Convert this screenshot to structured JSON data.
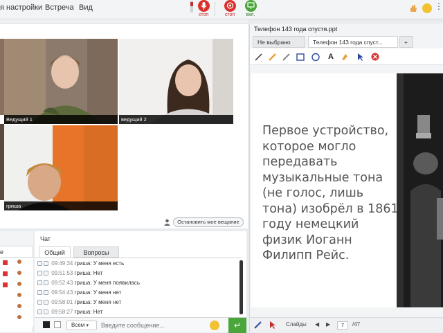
{
  "menu": {
    "items": [
      "я настройки",
      "Встреча",
      "Вид"
    ]
  },
  "controls": {
    "mic_label": "стоп",
    "cam_label": "стоп",
    "share_label": "вкл."
  },
  "videos": {
    "host1_name": "Ведущий 1",
    "host2_name": "ведущий 2",
    "participant_name": "гриша",
    "stop_broadcast_label": "Остановить мое вещание"
  },
  "chat": {
    "title": "Чат",
    "tabs": [
      "Общий",
      "Вопросы"
    ],
    "messages": [
      {
        "time": "09:49:34",
        "text": "гриша: У меня есть"
      },
      {
        "time": "09:51:53",
        "text": "гриша: Нет"
      },
      {
        "time": "09:52:43",
        "text": "гриша: У меня появилась"
      },
      {
        "time": "09:54:43",
        "text": "гриша: У меня нет"
      },
      {
        "time": "09:58:01",
        "text": "гриша: У меня нет"
      },
      {
        "time": "09:58:27",
        "text": "гриша: Нет"
      }
    ],
    "recipient": "Всем",
    "input_placeholder": "Введите сообщение..."
  },
  "presentation": {
    "title": "Телефон 143 года спустя.ppt",
    "tabs": [
      "Не выбрано",
      "Телефон 143 года спуст..."
    ],
    "slide_text": "Первое устройство, которое могло передавать музыкальные тона (не голос, лишь тона) изобрёл в 1861 году немецкий физик Иоганн Филипп Рейс.",
    "footer_label": "Слайды",
    "current_page": "7",
    "total_pages": "/47"
  },
  "colors": {
    "accent_green": "#4aa63a",
    "stop_red": "#d9322e"
  }
}
